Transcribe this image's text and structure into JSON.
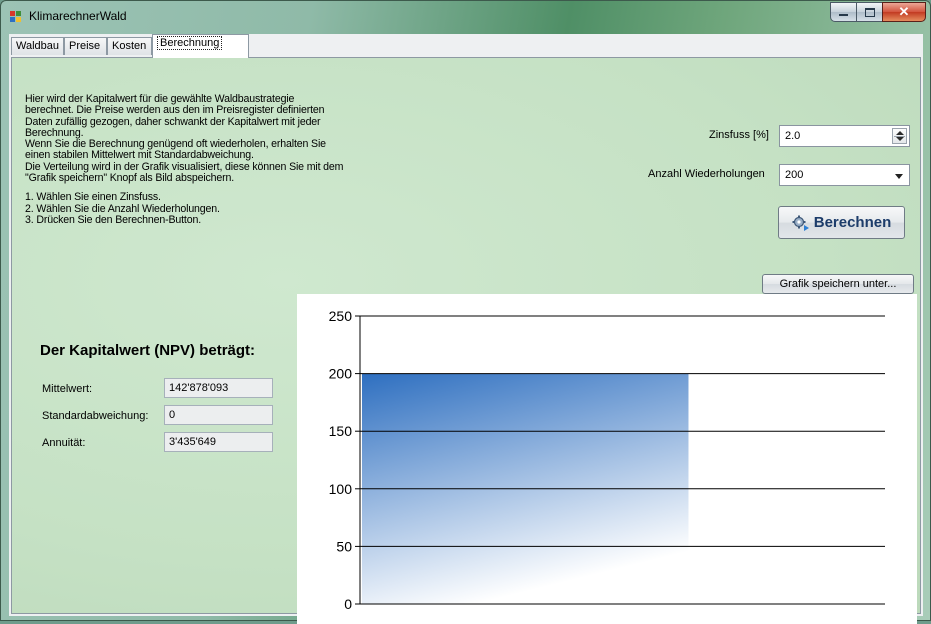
{
  "window": {
    "title": "KlimarechnerWald"
  },
  "tabs": [
    {
      "label": "Waldbau",
      "active": false
    },
    {
      "label": "Preise",
      "active": false
    },
    {
      "label": "Kosten",
      "active": false
    },
    {
      "label": "Berechnung",
      "active": true
    }
  ],
  "description": {
    "paragraph": [
      "Hier wird der Kapitalwert für die gewählte Waldbaustrategie",
      "berechnet. Die Preise werden aus den im Preisregister definierten",
      "Daten zufällig gezogen, daher schwankt der Kapitalwert mit jeder",
      "Berechnung.",
      "Wenn Sie die Berechnung genügend oft wiederholen, erhalten Sie",
      "einen stabilen Mittelwert mit Standardabweichung.",
      "Die Verteilung wird in der Grafik visualisiert, diese können Sie mit dem",
      "\"Grafik speichern\" Knopf als Bild abspeichern."
    ],
    "steps": [
      "1. Wählen Sie einen Zinsfuss.",
      "2. Wählen Sie die Anzahl Wiederholungen.",
      "3. Drücken Sie den Berechnen-Button."
    ]
  },
  "controls": {
    "zinsfuss_label": "Zinsfuss [%]",
    "zinsfuss_value": "2.0",
    "wiederholungen_label": "Anzahl Wiederholungen",
    "wiederholungen_value": "200",
    "berechnen_label": "Berechnen",
    "grafik_label": "Grafik speichern unter..."
  },
  "results": {
    "heading": "Der Kapitalwert (NPV) beträgt:",
    "mittelwert_label": "Mittelwert:",
    "mittelwert_value": "142'878'093",
    "std_label": "Standardabweichung:",
    "std_value": "0",
    "annuitaet_label": "Annuität:",
    "annuitaet_value": "3'435'649"
  },
  "chart_data": {
    "type": "bar",
    "categories": [
      ""
    ],
    "values": [
      200
    ],
    "ylim": [
      0,
      250
    ],
    "yticks": [
      0,
      50,
      100,
      150,
      200,
      250
    ],
    "grid": true,
    "bar_color_top": "#2e6fc0",
    "bar_color_bottom": "#ffffff"
  }
}
